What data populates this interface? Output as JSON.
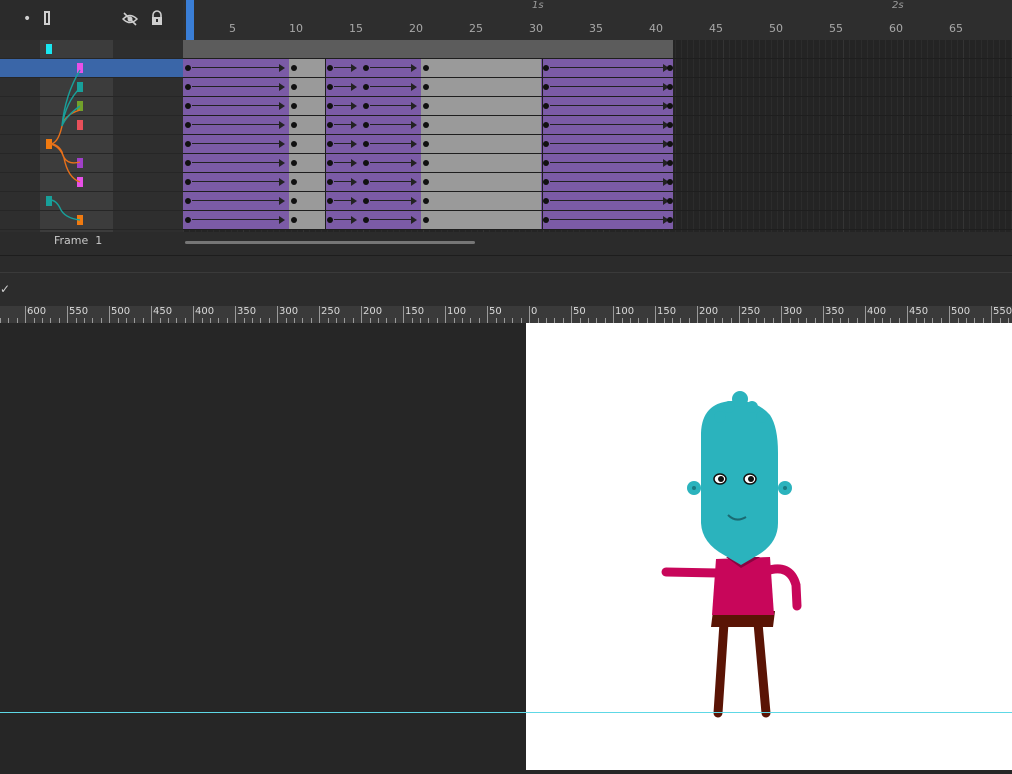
{
  "timeline": {
    "header_icons": [
      "dot-icon",
      "outline-rect-icon",
      "eye-hidden-icon",
      "lock-icon"
    ],
    "frame_numbers": [
      "5",
      "10",
      "15",
      "20",
      "25",
      "30",
      "35",
      "40",
      "45",
      "50",
      "55",
      "60",
      "65"
    ],
    "seconds": [
      "1s",
      "2s"
    ],
    "frame_label": "Frame",
    "current_frame": "1",
    "layers": [
      {
        "color": "#19e6f0",
        "selected": false
      },
      {
        "color": "#e850e8",
        "selected": true
      },
      {
        "color": "#18a09a",
        "selected": false
      },
      {
        "color": "#72a02a",
        "selected": false
      },
      {
        "color": "#e8505a",
        "selected": false
      },
      {
        "color": "#f07a10",
        "selected": false
      },
      {
        "color": "#a040c8",
        "selected": false
      },
      {
        "color": "#e850e8",
        "selected": false
      },
      {
        "color": "#18a09a",
        "selected": false
      },
      {
        "color": "#f07a10",
        "selected": false
      }
    ]
  },
  "ruler": {
    "left_labels": [
      "600",
      "550",
      "500",
      "450",
      "400",
      "350",
      "300",
      "250",
      "200",
      "150",
      "100",
      "50",
      "0"
    ],
    "right_labels": [
      "50",
      "100",
      "150",
      "200",
      "250",
      "300",
      "350",
      "400",
      "450",
      "500",
      "550"
    ]
  },
  "colors": {
    "tween": "#7b5ba6",
    "static": "#9a9a9a",
    "character_skin": "#2bb3bd",
    "shirt": "#c8065a",
    "pants": "#5a1405",
    "guide": "#5ed8e6"
  }
}
